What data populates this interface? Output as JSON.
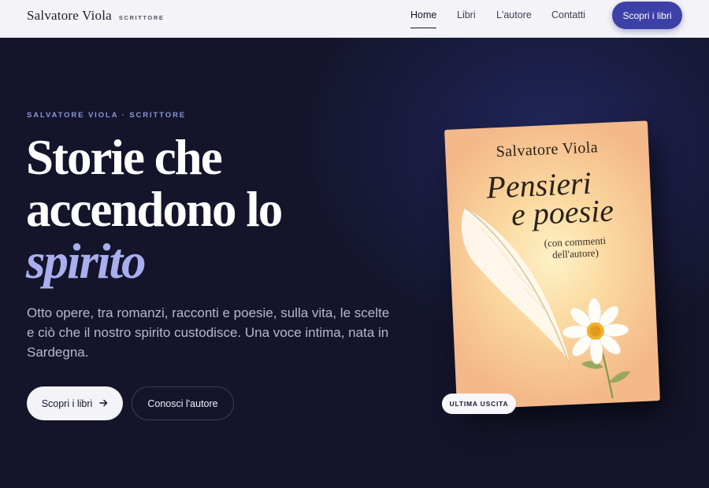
{
  "nav": {
    "brand_name": "Salvatore Viola",
    "brand_tag": "SCRITTORE",
    "links": [
      {
        "label": "Home",
        "active": true
      },
      {
        "label": "Libri",
        "active": false
      },
      {
        "label": "L'autore",
        "active": false
      },
      {
        "label": "Contatti",
        "active": false
      }
    ],
    "cta_label": "Scopri i libri"
  },
  "hero": {
    "eyebrow": "SALVATORE VIOLA · SCRITTORE",
    "headline_line1": "Storie che",
    "headline_line2": "accendono lo",
    "headline_accent": "spirito",
    "lead": "Otto opere, tra romanzi, racconti e poesie, sulla vita, le scelte e ciò che il nostro spirito custodisce. Una voce intima, nata in Sardegna.",
    "primary_label": "Scopri i libri",
    "primary_icon": "arrow-right-icon",
    "secondary_label": "Conosci l'autore"
  },
  "book": {
    "author": "Salvatore Viola",
    "title_line1": "Pensieri",
    "title_line2": "e poesie",
    "subtitle_line1": "(con commenti",
    "subtitle_line2": "dell'autore)",
    "badge": "ULTIMA USCITA"
  },
  "colors": {
    "accent": "#3d40a6",
    "hero_bg": "#14152b",
    "headline_accent": "#a9aeee"
  }
}
